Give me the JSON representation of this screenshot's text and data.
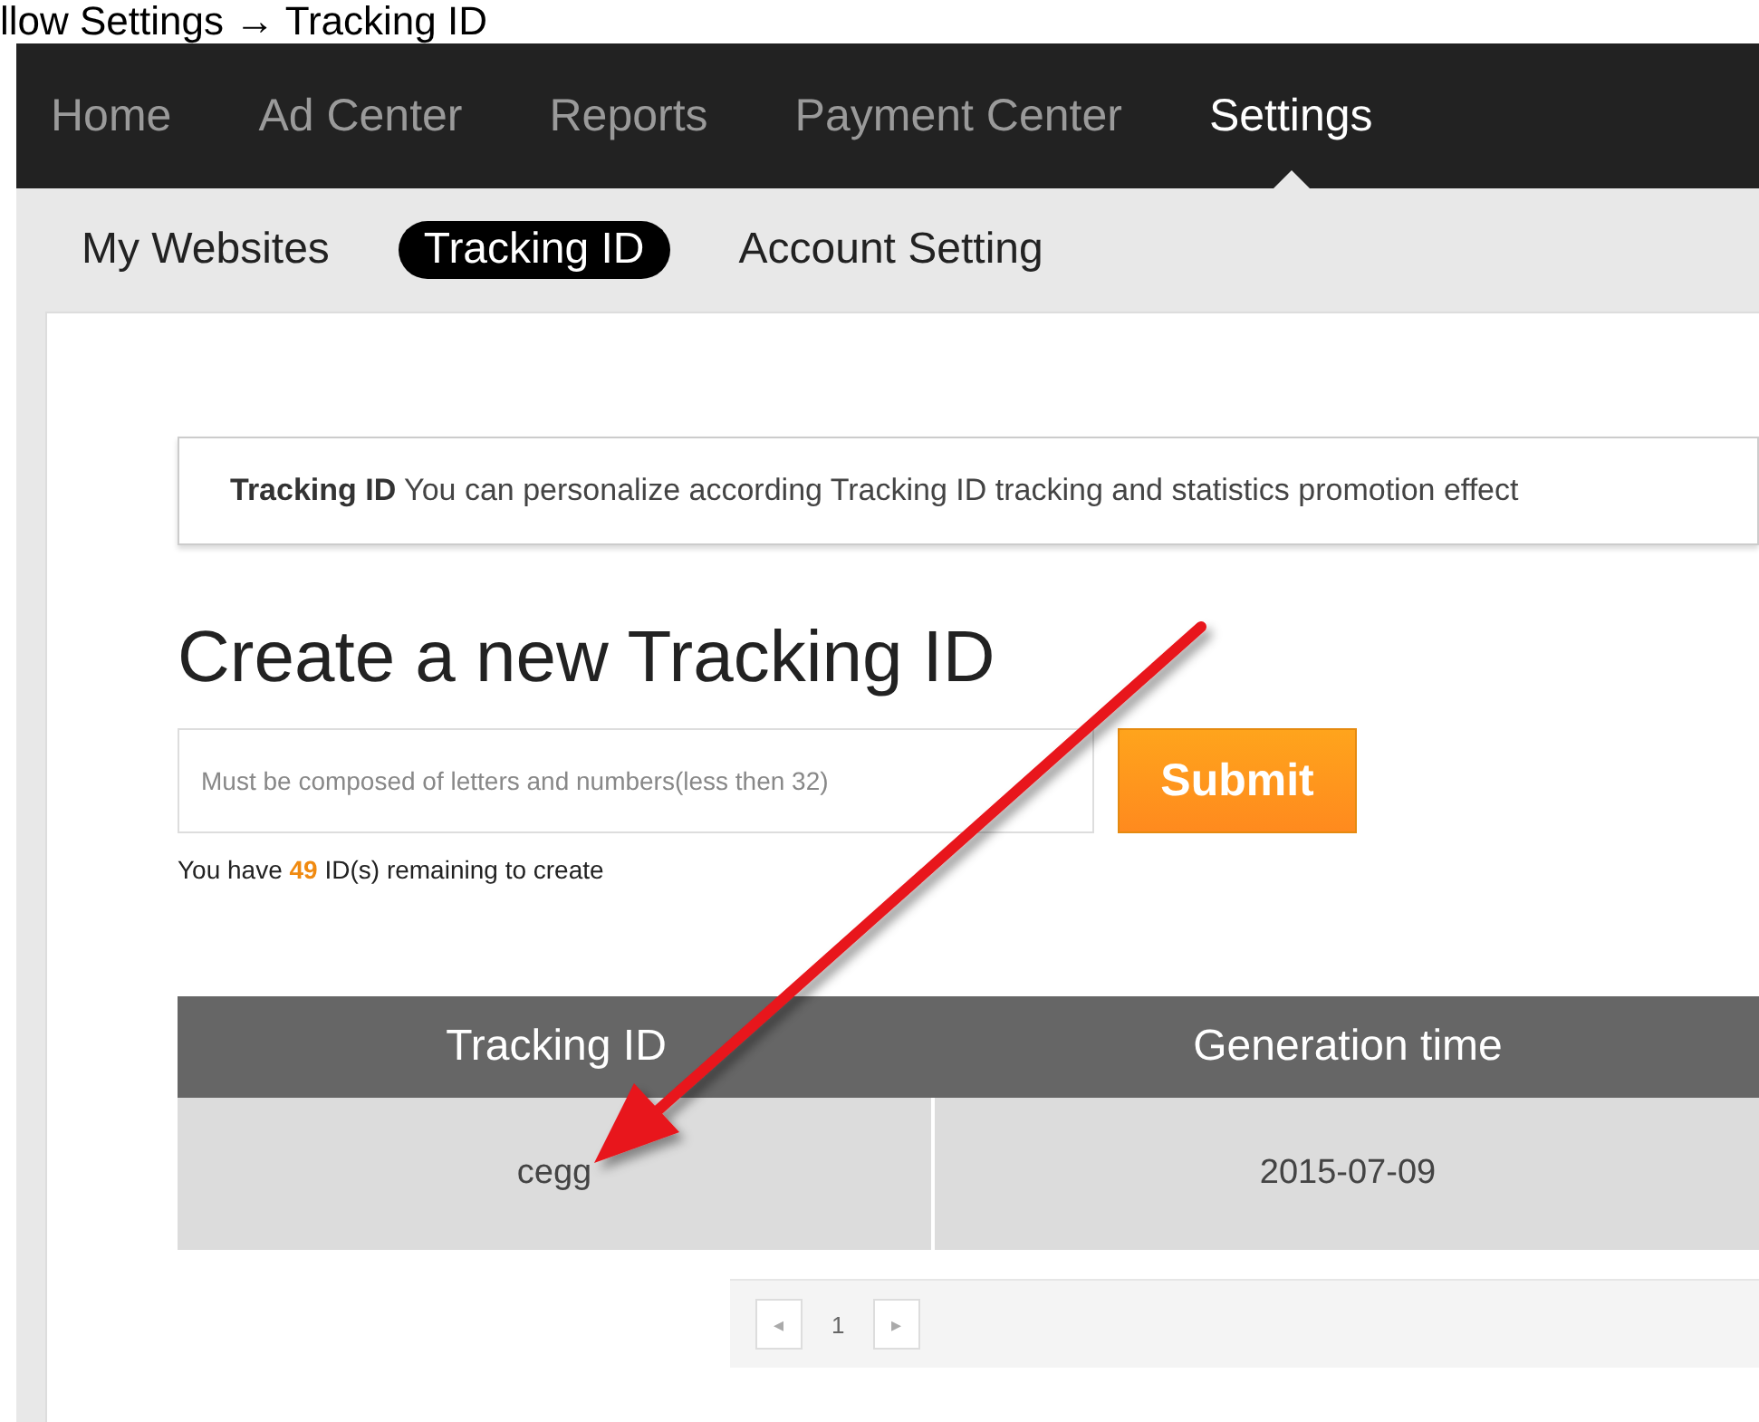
{
  "caption": "llow Settings → Tracking ID",
  "nav": [
    {
      "label": "Home",
      "selected": false
    },
    {
      "label": "Ad Center",
      "selected": false
    },
    {
      "label": "Reports",
      "selected": false
    },
    {
      "label": "Payment Center",
      "selected": false
    },
    {
      "label": "Settings",
      "selected": true
    }
  ],
  "subnav": [
    {
      "label": "My Websites",
      "selected": false
    },
    {
      "label": "Tracking ID",
      "selected": true
    },
    {
      "label": "Account Setting",
      "selected": false
    }
  ],
  "notice": "**Tracking ID** You can personalize according Tracking ID tracking and statistics promotion effect",
  "heading": "Create a new Tracking ID",
  "field": {
    "placeholder": "Must be composed of letters and numbers(less then 32)"
  },
  "submit": "Submit",
  "remaining": {
    "before": "You have",
    "count": "49",
    "after": "ID(s) remaining to create"
  },
  "table": {
    "columns": [
      "Tracking ID",
      "Generation time"
    ],
    "rows": [
      [
        "cegg",
        "2015-07-09"
      ]
    ]
  },
  "pager": {
    "prev": "◂",
    "page": "1",
    "next": "▸"
  }
}
